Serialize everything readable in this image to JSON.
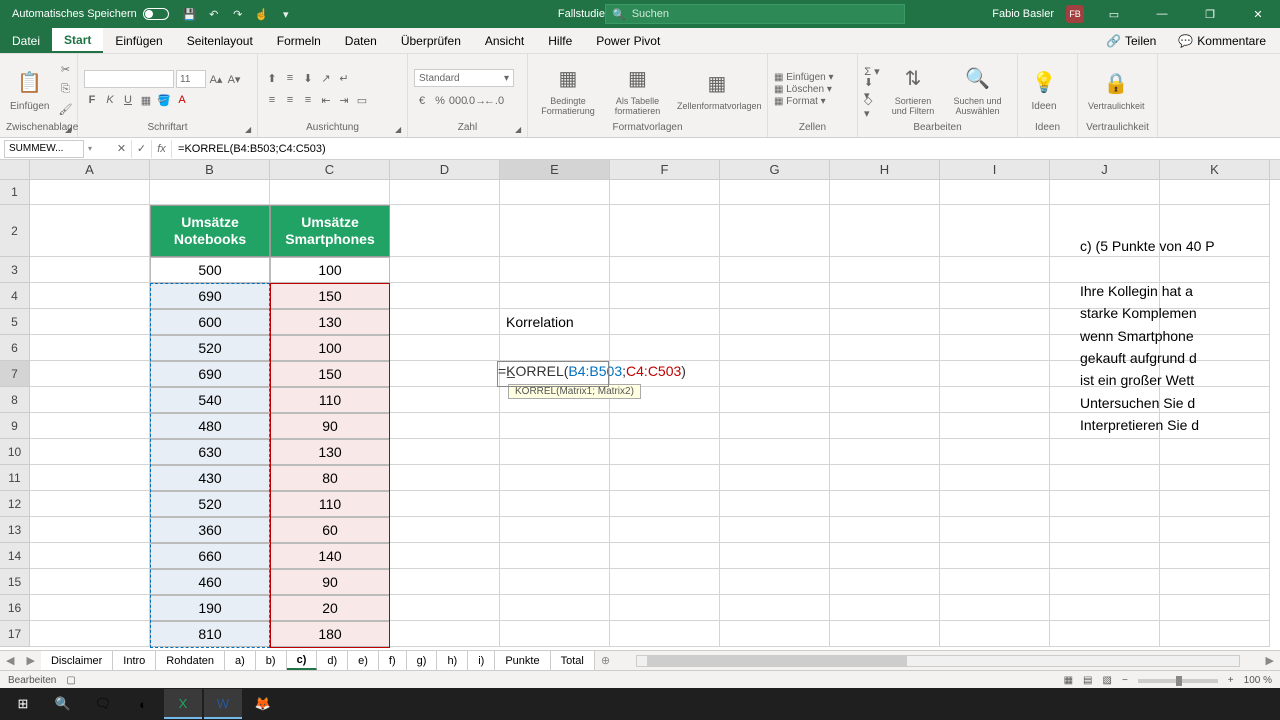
{
  "titlebar": {
    "autosave": "Automatisches Speichern",
    "doc_title": "Fallstudie Portfoliomanagement",
    "search_placeholder": "Suchen",
    "user_name": "Fabio Basler",
    "user_initials": "FB"
  },
  "tabs": {
    "file": "Datei",
    "home": "Start",
    "insert": "Einfügen",
    "layout": "Seitenlayout",
    "formulas": "Formeln",
    "data": "Daten",
    "review": "Überprüfen",
    "view": "Ansicht",
    "help": "Hilfe",
    "powerpivot": "Power Pivot",
    "share": "Teilen",
    "comments": "Kommentare"
  },
  "ribbon": {
    "clipboard": {
      "label": "Zwischenablage",
      "paste": "Einfügen"
    },
    "font": {
      "label": "Schriftart",
      "size": "11"
    },
    "alignment": {
      "label": "Ausrichtung"
    },
    "number": {
      "label": "Zahl",
      "format": "Standard"
    },
    "styles": {
      "label": "Formatvorlagen",
      "cond": "Bedingte Formatierung",
      "table": "Als Tabelle formatieren",
      "cell": "Zellenformatvorlagen"
    },
    "cells": {
      "label": "Zellen",
      "insert": "Einfügen",
      "delete": "Löschen",
      "format": "Format"
    },
    "editing": {
      "label": "Bearbeiten",
      "sort": "Sortieren und Filtern",
      "find": "Suchen und Auswählen"
    },
    "ideas": {
      "label": "Ideen",
      "btn": "Ideen"
    },
    "sensitivity": {
      "label": "Vertraulichkeit",
      "btn": "Vertraulichkeit"
    }
  },
  "formula_bar": {
    "name_box": "SUMMEW...",
    "formula": "=KORREL(B4:B503;C4:C503)"
  },
  "columns": [
    "A",
    "B",
    "C",
    "D",
    "E",
    "F",
    "G",
    "H",
    "I",
    "J",
    "K"
  ],
  "row_numbers": [
    "1",
    "2",
    "3",
    "4",
    "5",
    "6",
    "7",
    "8",
    "9",
    "10",
    "11",
    "12",
    "13",
    "14",
    "15",
    "16",
    "17"
  ],
  "headers": {
    "b": "Umsätze Notebooks",
    "c": "Umsätze Smartphones"
  },
  "data_b": [
    "500",
    "690",
    "600",
    "520",
    "690",
    "540",
    "480",
    "630",
    "430",
    "520",
    "360",
    "660",
    "460",
    "190",
    "810"
  ],
  "data_c": [
    "100",
    "150",
    "130",
    "100",
    "150",
    "110",
    "90",
    "130",
    "80",
    "110",
    "60",
    "140",
    "90",
    "20",
    "180"
  ],
  "e5": "Korrelation",
  "e7_formula": {
    "prefix": "=K̲ORREL(",
    "ref1": "B4:B503",
    "sep": ";",
    "ref2": "C4:C503",
    "suffix": ")"
  },
  "tooltip": "KORREL(Matrix1; Matrix2)",
  "right_text": {
    "l1": "c)   (5 Punkte von 40 P",
    "l2": "Ihre Kollegin hat a",
    "l3": "starke Komplemen",
    "l4": "wenn Smartphone",
    "l5": "gekauft aufgrund d",
    "l6": "ist ein großer Wett",
    "l7": "Untersuchen Sie d",
    "l8": "Interpretieren Sie d"
  },
  "sheet_tabs": [
    "Disclaimer",
    "Intro",
    "Rohdaten",
    "a)",
    "b)",
    "c)",
    "d)",
    "e)",
    "f)",
    "g)",
    "h)",
    "i)",
    "Punkte",
    "Total"
  ],
  "active_sheet": "c)",
  "status": {
    "mode": "Bearbeiten",
    "zoom": "100 %"
  },
  "chart_data": {
    "type": "table",
    "title": "Umsätze",
    "columns": [
      "Umsätze Notebooks",
      "Umsätze Smartphones"
    ],
    "rows": [
      [
        500,
        100
      ],
      [
        690,
        150
      ],
      [
        600,
        130
      ],
      [
        520,
        100
      ],
      [
        690,
        150
      ],
      [
        540,
        110
      ],
      [
        480,
        90
      ],
      [
        630,
        130
      ],
      [
        430,
        80
      ],
      [
        520,
        110
      ],
      [
        360,
        60
      ],
      [
        660,
        140
      ],
      [
        460,
        90
      ],
      [
        190,
        20
      ],
      [
        810,
        180
      ]
    ],
    "analysis": {
      "label": "Korrelation",
      "formula": "=KORREL(B4:B503;C4:C503)"
    }
  }
}
